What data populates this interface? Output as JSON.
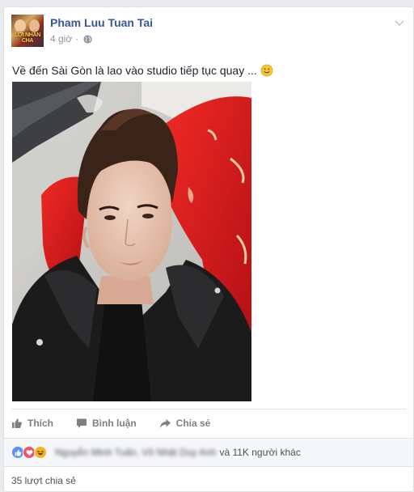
{
  "post": {
    "author": "Pham Luu Tuan Tai",
    "time": "4 giờ",
    "dot": "·",
    "avatar_text": "LỜI NHẮN CHA",
    "text": "Về đến Sài Gòn là lao vào studio tiếp tục quay ...",
    "icons": {
      "privacy": "globe-icon",
      "emoji": "smile-icon",
      "menu": "chevron-down-icon"
    }
  },
  "actions": {
    "like": "Thích",
    "comment": "Bình luận",
    "share": "Chia sẻ"
  },
  "reactions": {
    "names": "Nguyễn Minh Tuấn, Võ Nhật Duy Anh",
    "tail": "và 11K người khác",
    "types": [
      "like-icon",
      "love-icon",
      "haha-icon"
    ]
  },
  "shares": "35 lượt chia sẻ",
  "colors": {
    "brand": "#365899",
    "like": "#5890ff",
    "love": "#f25268",
    "haha": "#f7b125",
    "muted": "#90949c",
    "jacket": "#1b1b1c",
    "chair": "#e4141b"
  }
}
